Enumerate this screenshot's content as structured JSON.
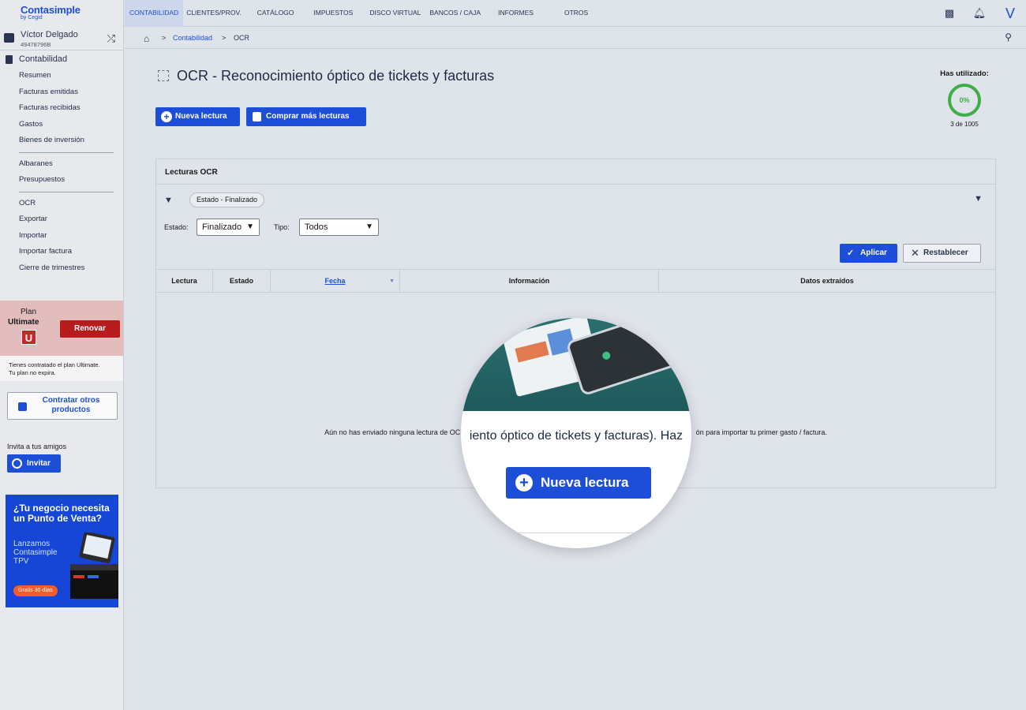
{
  "brand": {
    "name": "Contasimple",
    "sub": "by Cegid",
    "accent": "#1d4ed8"
  },
  "topnav": [
    "CONTABILIDAD",
    "CLIENTES/PROV.",
    "CATÁLOGO",
    "IMPUESTOS",
    "DISCO VIRTUAL",
    "BANCOS / CAJA",
    "INFORMES",
    "OTROS"
  ],
  "topicons": {
    "help": "help-icon",
    "bell": "bell-icon",
    "logo": "V"
  },
  "user": {
    "name": "Víctor Delgado",
    "id": "49478796B"
  },
  "sidebar": {
    "section": "Contabilidad",
    "group1": [
      "Resumen",
      "Facturas emitidas",
      "Facturas recibidas",
      "Gastos",
      "Bienes de inversión"
    ],
    "group2": [
      "Albaranes",
      "Presupuestos"
    ],
    "group3": [
      "OCR",
      "Exportar",
      "Importar",
      "Importar factura",
      "Cierre de trimestres"
    ]
  },
  "plan": {
    "label": "Plan",
    "name": "Ultimate",
    "badge": "U",
    "renew": "Renovar",
    "note_line1": "Tienes contratado el plan Ultimate.",
    "note_line2": "Tu plan no expira."
  },
  "contratar": "Contratar otros productos",
  "invite": {
    "text": "Invita a tus amigos",
    "button": "Invitar"
  },
  "ad": {
    "headline": "¿Tu negocio necesita un Punto de Venta?",
    "body": "Lanzamos Contasimple TPV",
    "cta": "Gratis 30 días"
  },
  "breadcrumb": {
    "section": "Contabilidad",
    "current": "OCR"
  },
  "page": {
    "title": "OCR - Reconocimiento óptico de tickets y facturas",
    "btn_new": "Nueva lectura",
    "btn_buy": "Comprar más lecturas"
  },
  "usage": {
    "label": "Has utilizado:",
    "percent": "0%",
    "count": "3 de 1005"
  },
  "panel": {
    "title": "Lecturas OCR",
    "chip": "Estado - Finalizado",
    "estado_label": "Estado:",
    "estado_value": "Finalizado",
    "tipo_label": "Tipo:",
    "tipo_value": "Todos",
    "apply": "Aplicar",
    "reset": "Restablecer"
  },
  "table": {
    "columns": [
      "Lectura",
      "Estado",
      "Fecha",
      "Información",
      "Datos extraídos"
    ],
    "empty_left": "Aún no has enviado ninguna lectura de OCR",
    "empty_right": "ón para importar tu primer gasto / factura."
  },
  "magnifier": {
    "text": "iento óptico de tickets y facturas). Haz",
    "button": "Nueva lectura"
  }
}
